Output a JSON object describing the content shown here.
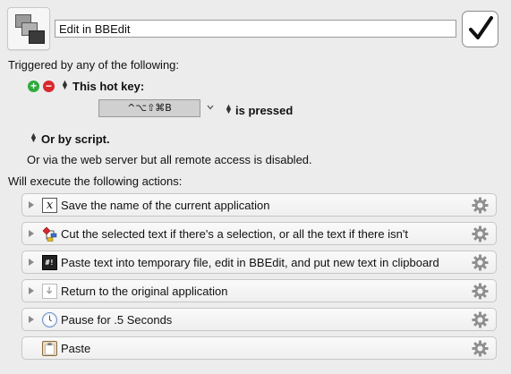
{
  "macro": {
    "name": "Edit in BBEdit",
    "enabled": true
  },
  "triggers": {
    "heading": "Triggered by any of the following:",
    "hotkey_label": "This hot key:",
    "hotkey_value": "^⌥⇧⌘B",
    "condition": "is pressed",
    "script_label": "Or by script.",
    "web_server_text": "Or via the web server but all remote access is disabled."
  },
  "actions_section": {
    "heading": "Will execute the following actions:",
    "actions": [
      {
        "label": "Save the name of the current application",
        "icon": "variable-x-icon"
      },
      {
        "label": "Cut the selected text if there's a selection, or all the text if there isn't",
        "icon": "if-then-icon"
      },
      {
        "label": "Paste text into temporary file, edit in BBEdit, and put new text in clipboard",
        "icon": "shell-script-icon"
      },
      {
        "label": "Return to the original application",
        "icon": "return-app-icon"
      },
      {
        "label": "Pause for .5 Seconds",
        "icon": "clock-icon"
      },
      {
        "label": "Paste",
        "icon": "clipboard-icon"
      }
    ]
  },
  "colors": {
    "background": "#ececec",
    "add_green": "#2eaa3b",
    "remove_red": "#d8282c"
  }
}
